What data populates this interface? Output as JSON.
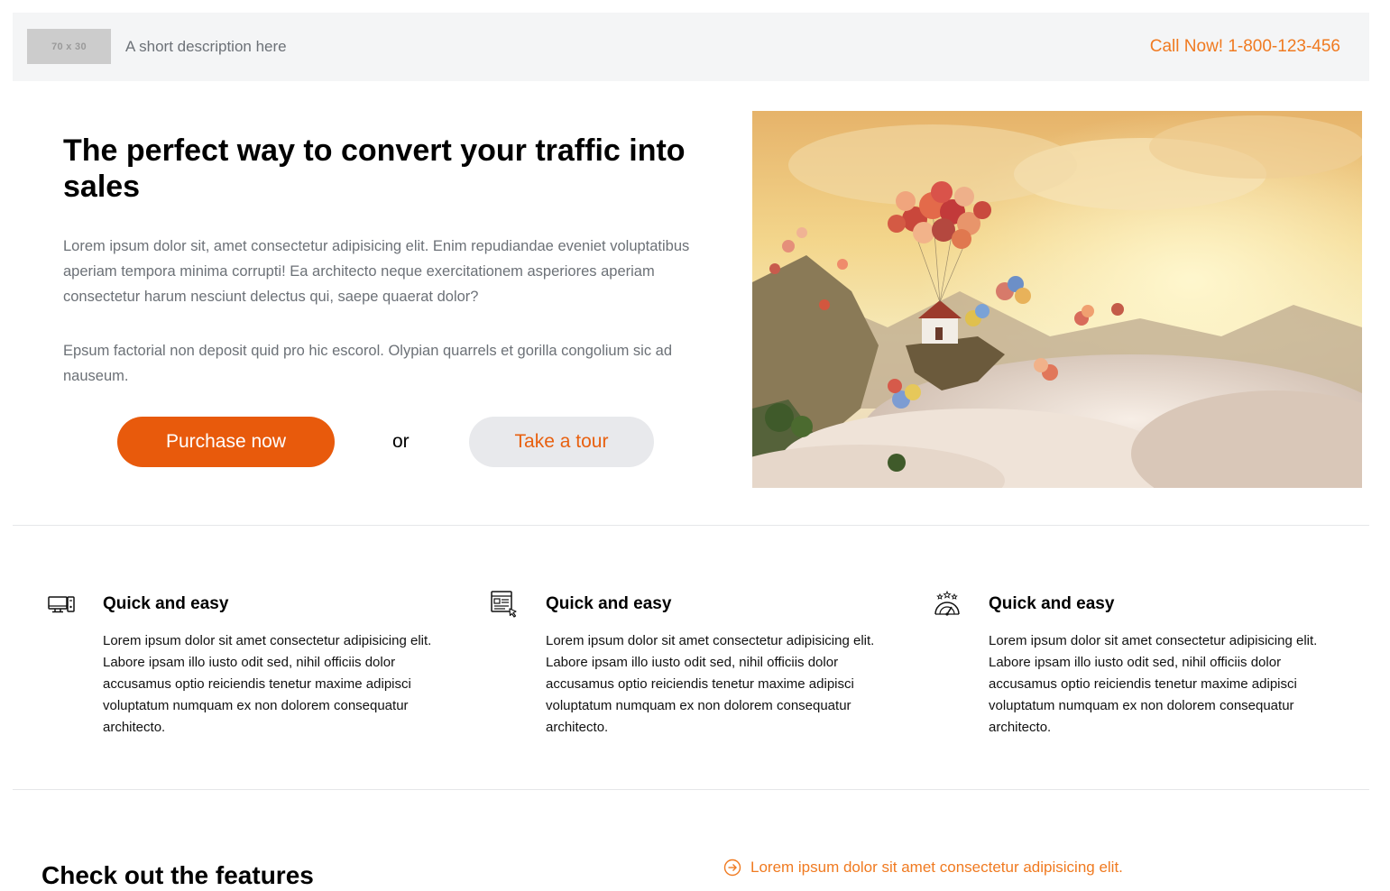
{
  "header": {
    "logo_placeholder": "70 x 30",
    "tagline": "A short description here",
    "call_now": "Call Now! 1-800-123-456"
  },
  "hero": {
    "title": "The perfect way to convert your traffic into sales",
    "paragraph_1": "Lorem ipsum dolor sit, amet consectetur adipisicing elit. Enim repudiandae eveniet voluptatibus aperiam tempora minima corrupti! Ea architecto neque exercitationem asperiores aperiam consectetur harum nesciunt delectus qui, saepe quaerat dolor?",
    "paragraph_2": "Epsum factorial non deposit quid pro hic escorol. Olypian quarrels et gorilla congolium sic ad nauseum.",
    "purchase_label": "Purchase now",
    "or_label": "or",
    "tour_label": "Take a tour",
    "image_icon": "floating-balloon-house-image"
  },
  "features": [
    {
      "icon": "computer-icon",
      "title": "Quick and easy",
      "text": "Lorem ipsum dolor sit amet consectetur adipisicing elit. Labore ipsam illo iusto odit sed, nihil officiis dolor accusamus optio reiciendis tenetur maxime adipisci voluptatum numquam ex non dolorem consequatur architecto."
    },
    {
      "icon": "web-page-cursor-icon",
      "title": "Quick and easy",
      "text": "Lorem ipsum dolor sit amet consectetur adipisicing elit. Labore ipsam illo iusto odit sed, nihil officiis dolor accusamus optio reiciendis tenetur maxime adipisci voluptatum numquam ex non dolorem consequatur architecto."
    },
    {
      "icon": "speedometer-stars-icon",
      "title": "Quick and easy",
      "text": "Lorem ipsum dolor sit amet consectetur adipisicing elit. Labore ipsam illo iusto odit sed, nihil officiis dolor accusamus optio reiciendis tenetur maxime adipisci voluptatum numquam ex non dolorem consequatur architecto."
    }
  ],
  "bottom": {
    "heading": "Check out the features",
    "link_text": "Lorem ipsum dolor sit amet consectetur adipisicing elit.",
    "link_icon": "circle-arrow-right-icon"
  },
  "colors": {
    "accent_orange": "#e85a0c",
    "link_orange": "#f07a20",
    "topbar_bg": "#f4f5f6",
    "muted_text": "#6c7177"
  }
}
